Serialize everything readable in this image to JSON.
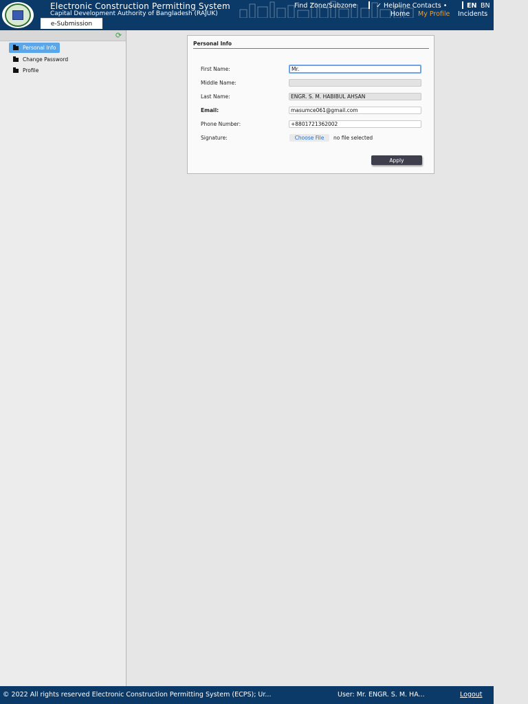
{
  "header": {
    "app_title": "Electronic Construction Permitting System",
    "app_subtitle": "Capital Development Authority of Bangladesh (RAJUK)",
    "find_zone": "Find Zone/Subzone",
    "helpline": "✓ Helpline Contacts •",
    "lang_en": "EN",
    "lang_bn": "BN",
    "home": "Home",
    "my_profile": "My Profile",
    "incidents": "Incidents",
    "tab_esubmission": "e-Submission",
    "active_nav_color": "#f0a030",
    "header_bg": "#0c3a68"
  },
  "sidebar": {
    "items": [
      {
        "label": "Personal Info",
        "icon": "folder-icon",
        "active": true
      },
      {
        "label": "Change Password",
        "icon": "folder-icon",
        "active": false
      },
      {
        "label": "Profile",
        "icon": "folder-icon",
        "active": false
      }
    ],
    "refresh_icon": "refresh-icon",
    "active_color": "#5aa6e8"
  },
  "form": {
    "title": "Personal Info",
    "first_name_label": "First Name:",
    "first_name_value": "Mr.",
    "middle_name_label": "Middle Name:",
    "middle_name_value": "",
    "last_name_label": "Last Name:",
    "last_name_value": "ENGR. S. M. HABIBUL AHSAN",
    "email_label": "Email:",
    "email_value": "masumce061@gmail.com",
    "phone_label": "Phone Number:",
    "phone_value": "+8801721362002",
    "signature_label": "Signature:",
    "choose_file": "Choose File",
    "file_status": "no file selected",
    "apply_label": "Apply"
  },
  "footer": {
    "copyright": "© 2022 All rights reserved Electronic Construction Permitting System (ECPS); Ur...",
    "user": "User: Mr. ENGR. S. M. HA...",
    "logout": "Logout"
  }
}
